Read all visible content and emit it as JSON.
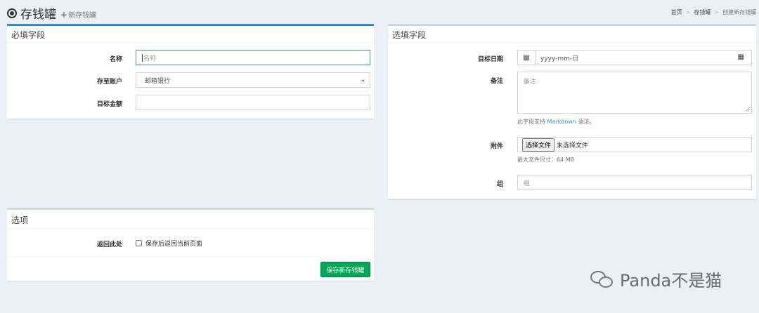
{
  "header": {
    "title": "存钱罐",
    "subtitle": "新存钱罐",
    "breadcrumb": [
      "首页",
      "存钱罐",
      "创建新存钱罐"
    ]
  },
  "required": {
    "title": "必填字段",
    "name_label": "名称",
    "name_placeholder": "名称",
    "account_label": "存至账户",
    "account_value": "邮箱银行",
    "amount_label": "目标金额"
  },
  "optional": {
    "title": "选填字段",
    "date_label": "目标日期",
    "date_placeholder": "yyyy-mm-日",
    "notes_label": "备注",
    "notes_placeholder": "备注",
    "notes_help_prefix": "此字段支持 ",
    "notes_help_link": "Markdown",
    "notes_help_suffix": " 语法。",
    "attach_label": "附件",
    "file_button": "选择文件",
    "file_status": "未选择文件",
    "file_help": "最大文件尺寸：64 MB",
    "group_label": "组",
    "group_placeholder": "组"
  },
  "options": {
    "title": "选项",
    "return_label": "返回此处",
    "return_checkbox": "保存后返回当前页面",
    "save_button": "保存新存钱罐"
  },
  "watermark": {
    "text": "Panda不是猫"
  },
  "colors": {
    "accent": "#3c8dbc",
    "success": "#00a65a",
    "background": "#ecf0f5"
  }
}
